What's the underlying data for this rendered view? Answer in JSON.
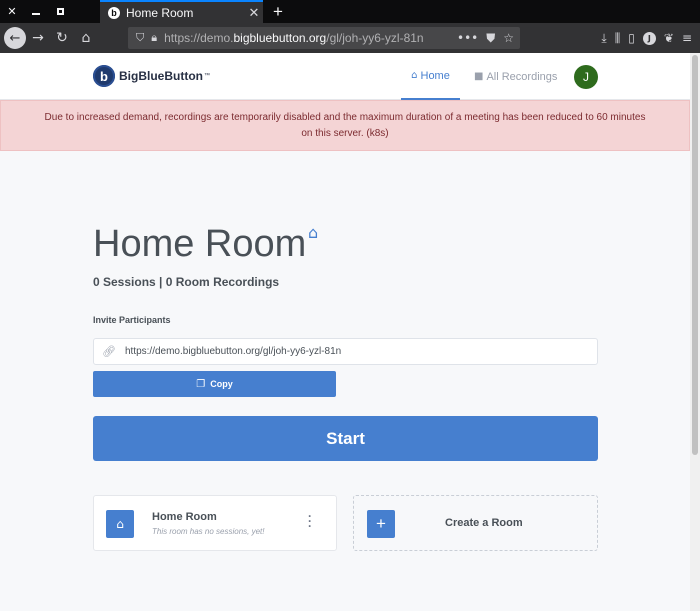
{
  "browser": {
    "tab_title": "Home Room",
    "url_host": "https://demo.",
    "url_domain": "bigbluebutton.org",
    "url_path": "/gl/joh-yy6-yzl-81n"
  },
  "header": {
    "logo_text": "BigBlueButton",
    "logo_tm": "™",
    "nav_home": "Home",
    "nav_recordings": "All Recordings",
    "avatar_initial": "J"
  },
  "alert": {
    "message": "Due to increased demand, recordings are temporarily disabled and the maximum duration of a meeting has been reduced to 60 minutes on this server. (k8s)"
  },
  "room": {
    "title": "Home Room",
    "stats": "0 Sessions | 0 Room Recordings",
    "invite_label": "Invite Participants",
    "invite_url": "https://demo.bigbluebutton.org/gl/joh-yy6-yzl-81n",
    "copy_label": "Copy",
    "start_label": "Start"
  },
  "cards": {
    "room_name": "Home Room",
    "room_sub": "This room has no sessions, yet!",
    "create_label": "Create a Room"
  },
  "colors": {
    "accent": "#467fcf",
    "alert_bg": "#f4d4d5",
    "avatar_bg": "#2e6b1d"
  }
}
